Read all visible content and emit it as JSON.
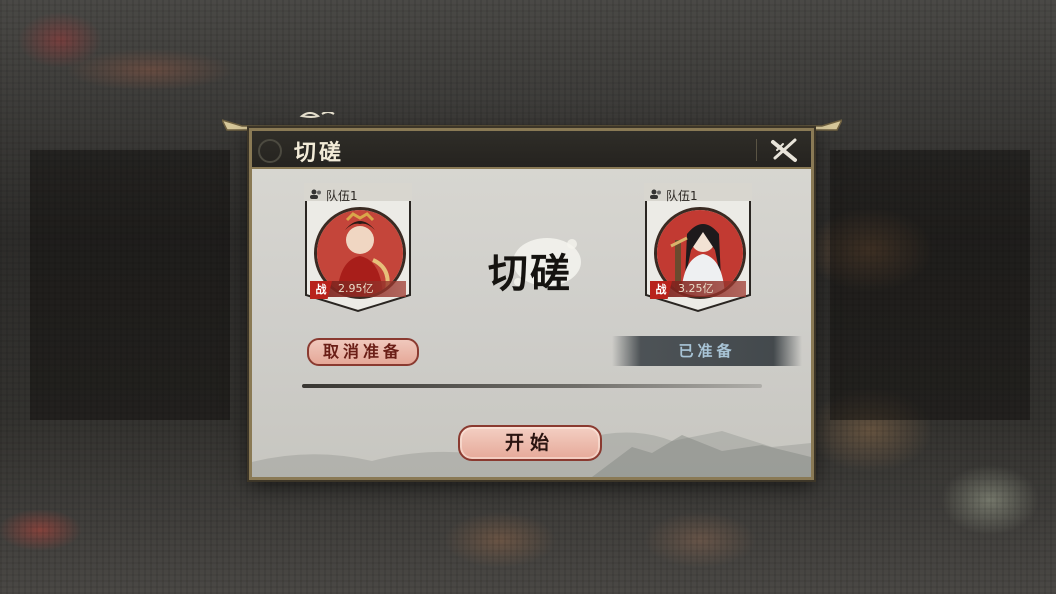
{
  "dialog": {
    "title": "切磋",
    "center_title": "切磋"
  },
  "teams": [
    {
      "label": "队伍1",
      "power_tag": "战",
      "power": "2.95亿",
      "status_button": "取消准备"
    },
    {
      "label": "队伍1",
      "power_tag": "战",
      "power": "3.25亿",
      "status_badge": "已准备"
    }
  ],
  "actions": {
    "start_label": "开始"
  },
  "colors": {
    "title_bar": "#2f2d28",
    "frame_gold": "#8a7a55",
    "button_pink": "#e6a999",
    "ready_text": "#a8c4d6"
  },
  "icons": {
    "close": "close-icon",
    "team": "team-icon"
  }
}
